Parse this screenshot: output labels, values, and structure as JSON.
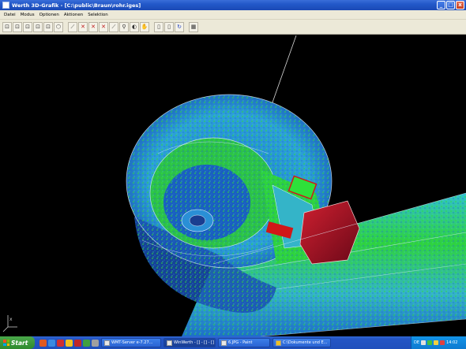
{
  "window": {
    "title": "Werth 3D-Grafik - [C:\\public\\Braun\\rohr.iges]",
    "min_label": "_",
    "max_label": "□",
    "close_label": "x"
  },
  "menu": {
    "items": [
      "Datei",
      "Modus",
      "Optionen",
      "Aktionen",
      "Selektion"
    ]
  },
  "toolbar": {
    "buttons": [
      "⊡",
      "⊡",
      "⊡",
      "⊡",
      "⊡",
      "⬡",
      "⟋",
      "✕",
      "✕",
      "✕",
      "⟋",
      "⚲",
      "◐",
      "✋",
      "▯",
      "▯",
      "↻",
      "▦"
    ]
  },
  "viewport": {
    "axis_label": "x",
    "colors": {
      "background": "#000000",
      "green": "#2ecc2e",
      "blue": "#2a8fd6",
      "cyan": "#34b4c8",
      "dark_red": "#8a1020",
      "red": "#d01818"
    }
  },
  "taskbar": {
    "start_label": "Start",
    "tasks": [
      "WMT-Server e-7.27...",
      "WinWerth - [] - [] - []",
      "6.JPG - Paint",
      "C:\\Dokumente und E..."
    ],
    "tray_lang": "DE",
    "clock": "14:02"
  }
}
